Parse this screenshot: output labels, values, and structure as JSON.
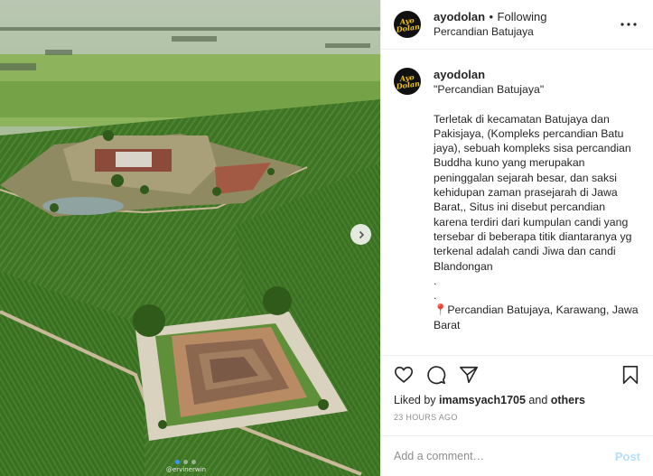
{
  "post": {
    "username": "ayodolan",
    "separator": "•",
    "follow_status": "Following",
    "location": "Percandian Batujaya",
    "avatar_text": "Ayo\nDolan",
    "caption_user": "ayodolan",
    "caption_text": "\"Percandian Batujaya\"\n\nTerletak di kecamatan Batujaya dan Pakisjaya, (Kompleks percandian Batu jaya), sebuah kompleks sisa percandian Buddha kuno yang merupakan peninggalan sejarah besar, dan saksi kehidupan zaman prasejarah di Jawa Barat,, Situs ini disebut percandian karena terdiri dari kumpulan candi yang tersebar di beberapa titik diantaranya yg terkenal adalah candi Jiwa dan candi Blandongan\n.\n.",
    "caption_pin": "📍",
    "caption_location": "Percandian Batujaya, Karawang, Jawa Barat",
    "liked_by_prefix": "Liked by ",
    "liked_by_user": "imamsyach1705",
    "liked_by_and": " and ",
    "liked_by_others": "others",
    "timestamp": "23 HOURS AGO",
    "comment_placeholder": "Add a comment…",
    "post_label": "Post",
    "photo_credit": "@ervinerwin",
    "carousel": {
      "total": 3,
      "active": 1
    }
  },
  "icons": {
    "more": "more-options-icon",
    "like": "heart-icon",
    "comment": "comment-icon",
    "share": "share-icon",
    "save": "bookmark-icon",
    "next": "chevron-right-icon"
  },
  "colors": {
    "accent": "#3897f0",
    "post_disabled": "#b2dffc",
    "muted": "#8e8e8e",
    "text": "#262626"
  }
}
